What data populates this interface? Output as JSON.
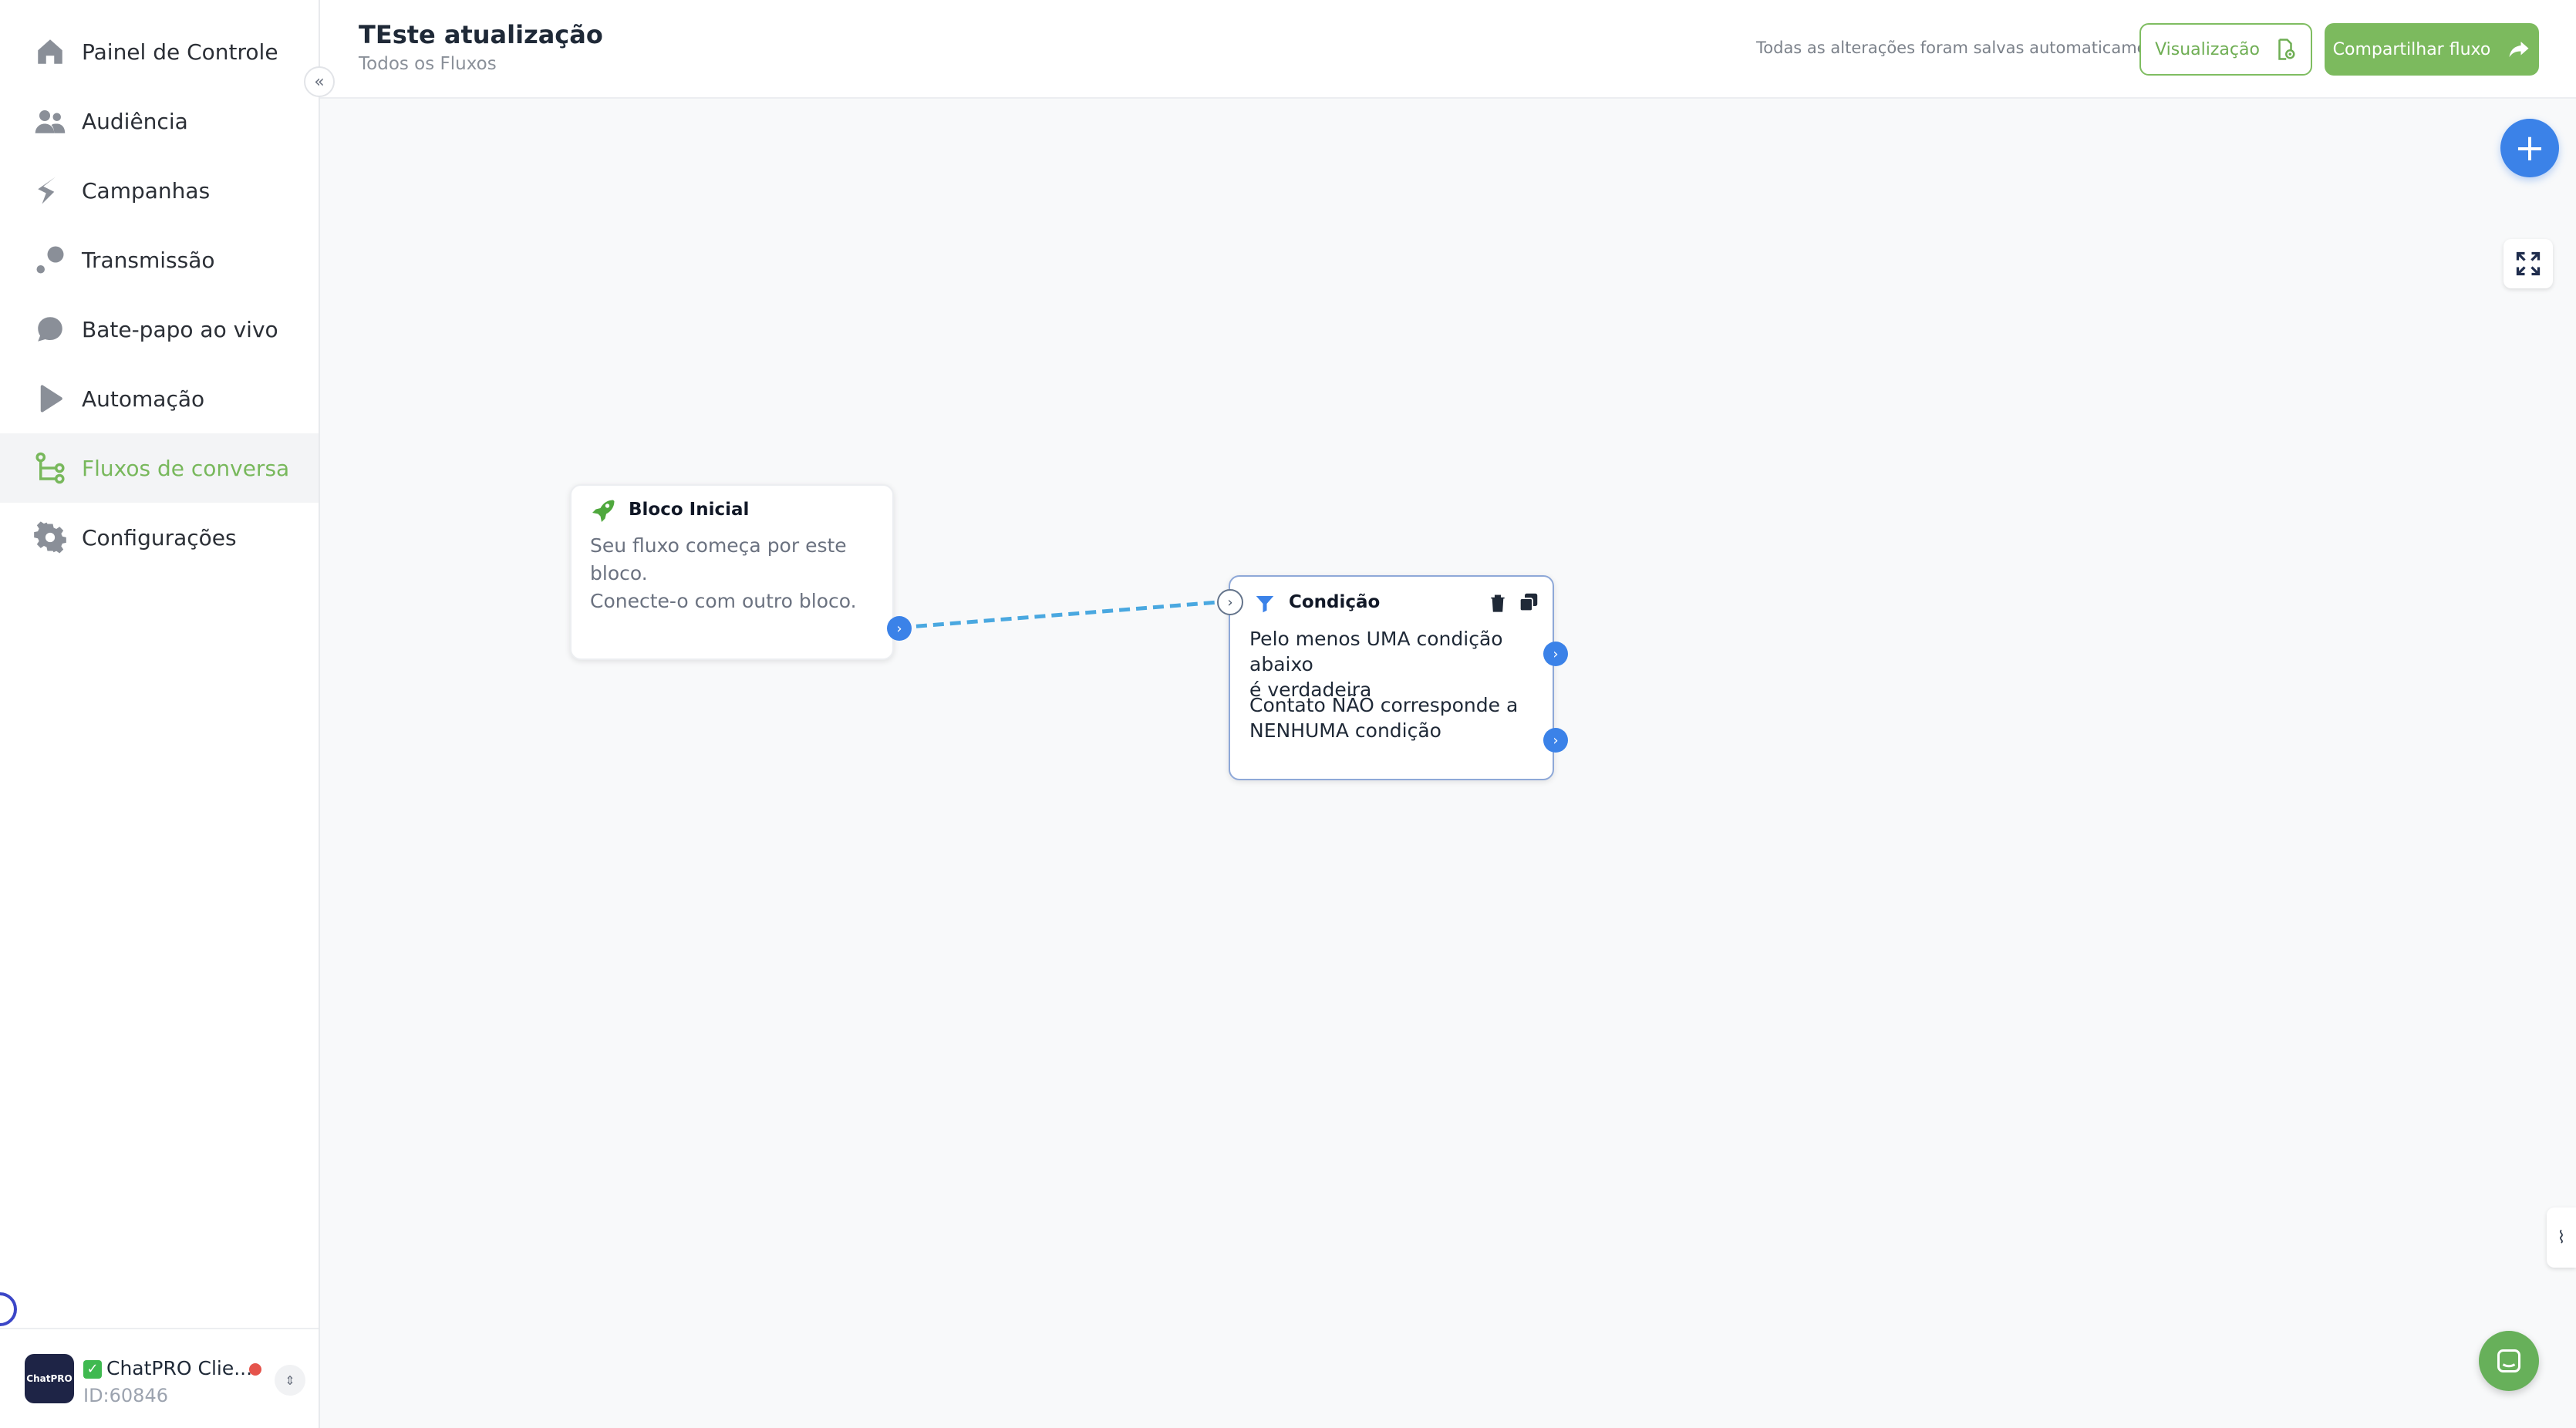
{
  "sidebar": {
    "items": [
      {
        "label": "Painel de Controle",
        "icon": "home-icon"
      },
      {
        "label": "Audiência",
        "icon": "users-icon"
      },
      {
        "label": "Campanhas",
        "icon": "campaign-icon"
      },
      {
        "label": "Transmissão",
        "icon": "broadcast-icon"
      },
      {
        "label": "Bate-papo ao vivo",
        "icon": "chat-icon"
      },
      {
        "label": "Automação",
        "icon": "automation-icon"
      },
      {
        "label": "Fluxos de conversa",
        "icon": "flow-icon",
        "active": true
      },
      {
        "label": "Configurações",
        "icon": "gear-icon"
      }
    ],
    "account": {
      "name": "ChatPRO Clie...",
      "id": "ID:60846",
      "avatar_text": "ChatPRO"
    }
  },
  "header": {
    "title": "TEste atualização",
    "breadcrumb": "Todos os Fluxos",
    "save_status": "Todas as alterações foram salvas automaticamente",
    "preview_label": "Visualização",
    "share_label": "Compartilhar fluxo"
  },
  "canvas": {
    "start_block": {
      "title": "Bloco Inicial",
      "description_line1": "Seu fluxo começa por este bloco.",
      "description_line2": "Conecte-o com outro bloco."
    },
    "condition_block": {
      "title": "Condição",
      "branch_true_line1": "Pelo menos UMA condição abaixo",
      "branch_true_line2": "é verdadeira",
      "branch_false_line1": "Contato NÃO corresponde a",
      "branch_false_line2": "NENHUMA condição"
    }
  },
  "colors": {
    "accent_green": "#7cba5e",
    "accent_blue": "#3b82e8",
    "connector": "#4aa8e0"
  }
}
